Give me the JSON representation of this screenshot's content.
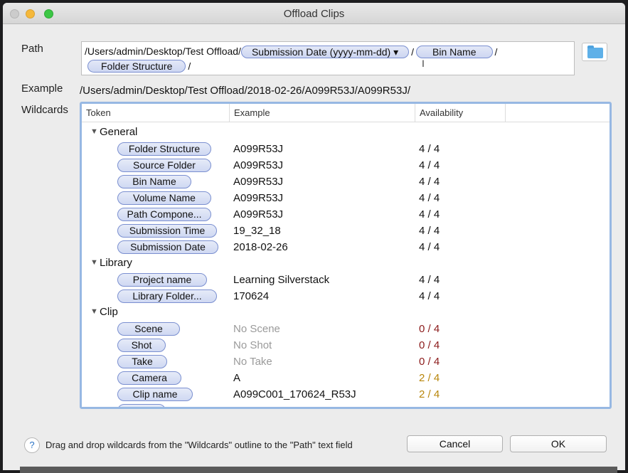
{
  "window": {
    "title": "Offload Clips"
  },
  "labels": {
    "path": "Path",
    "example": "Example",
    "wildcards": "Wildcards"
  },
  "path": {
    "segment1": "/Users/admin/Desktop/Test Offload/",
    "pill_submission_date": "Submission Date (yyyy-mm-dd) ▾",
    "sep1": "/",
    "pill_bin_name": "Bin Name",
    "sep2": "/",
    "pill_folder_structure": "Folder Structure",
    "sep3": "/"
  },
  "example_value": "/Users/admin/Desktop/Test Offload/2018-02-26/A099R53J/A099R53J/",
  "table": {
    "headers": {
      "token": "Token",
      "example": "Example",
      "availability": "Availability"
    },
    "groups": {
      "general": {
        "name": "General",
        "rows": [
          {
            "token": "Folder Structure",
            "example": "A099R53J",
            "availability": "4 / 4"
          },
          {
            "token": "Source Folder",
            "example": "A099R53J",
            "availability": "4 / 4"
          },
          {
            "token": "Bin Name",
            "example": "A099R53J",
            "availability": "4 / 4"
          },
          {
            "token": "Volume Name",
            "example": "A099R53J",
            "availability": "4 / 4"
          },
          {
            "token": "Path Compone...",
            "example": "A099R53J",
            "availability": "4 / 4"
          },
          {
            "token": "Submission Time",
            "example": "19_32_18",
            "availability": "4 / 4"
          },
          {
            "token": "Submission Date",
            "example": "2018-02-26",
            "availability": "4 / 4"
          }
        ]
      },
      "library": {
        "name": "Library",
        "rows": [
          {
            "token": "Project name",
            "example": "Learning Silverstack",
            "availability": "4 / 4"
          },
          {
            "token": "Library Folder...",
            "example": "170624",
            "availability": "4 / 4"
          }
        ]
      },
      "clip": {
        "name": "Clip",
        "rows": [
          {
            "token": "Scene",
            "example": "No Scene",
            "availability": "0 / 4"
          },
          {
            "token": "Shot",
            "example": "No Shot",
            "availability": "0 / 4"
          },
          {
            "token": "Take",
            "example": "No Take",
            "availability": "0 / 4"
          },
          {
            "token": "Camera",
            "example": "A",
            "availability": "2 / 4"
          },
          {
            "token": "Clip name",
            "example": "A099C001_170624_R53J",
            "availability": "2 / 4"
          }
        ]
      }
    }
  },
  "footer": {
    "help": "?",
    "hint": "Drag and drop wildcards from the \"Wildcards\" outline to the \"Path\" text field",
    "cancel": "Cancel",
    "ok": "OK"
  },
  "colors": {
    "selection_border": "#97b8e3",
    "pill_border": "#7a8fd0",
    "unavailable": "#8b1a1a",
    "partial": "#b8860b"
  }
}
